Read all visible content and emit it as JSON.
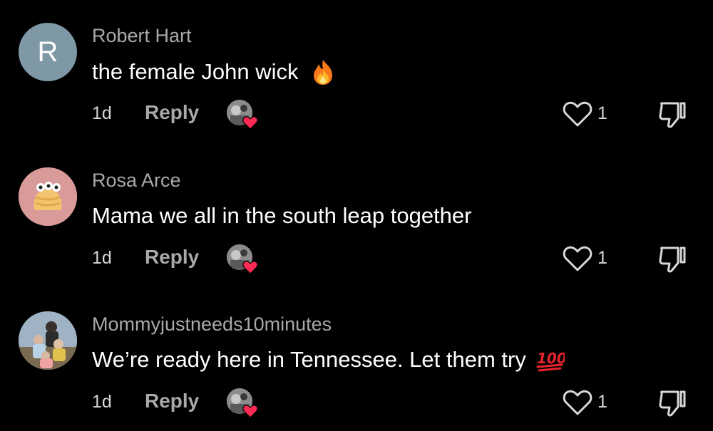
{
  "comments": [
    {
      "username": "Robert Hart",
      "text": "the female John wick",
      "emoji_icon": "fire-emoji",
      "avatar": {
        "type": "letter",
        "letter": "R",
        "color": "#7f98a5"
      },
      "time": "1d",
      "reply_label": "Reply",
      "like_count": "1"
    },
    {
      "username": "Rosa Arce",
      "text": "Mama we all in the south leap together",
      "emoji_icon": "",
      "avatar": {
        "type": "image",
        "icon": "cartoon-avatar",
        "color": "#d99a9a"
      },
      "time": "1d",
      "reply_label": "Reply",
      "like_count": "1"
    },
    {
      "username": "Mommyjustneeds10minutes",
      "text": "We’re ready here in Tennessee. Let them try",
      "emoji_icon": "hundred-points-emoji",
      "avatar": {
        "type": "image",
        "icon": "family-photo-avatar",
        "color": "#6b7a86"
      },
      "time": "1d",
      "reply_label": "Reply",
      "like_count": "1"
    }
  ],
  "colors": {
    "background": "#000000",
    "username": "#a9a9ad",
    "text": "#ffffff",
    "meta": "#d8d8d8",
    "heart_accent": "#fe2c55"
  }
}
